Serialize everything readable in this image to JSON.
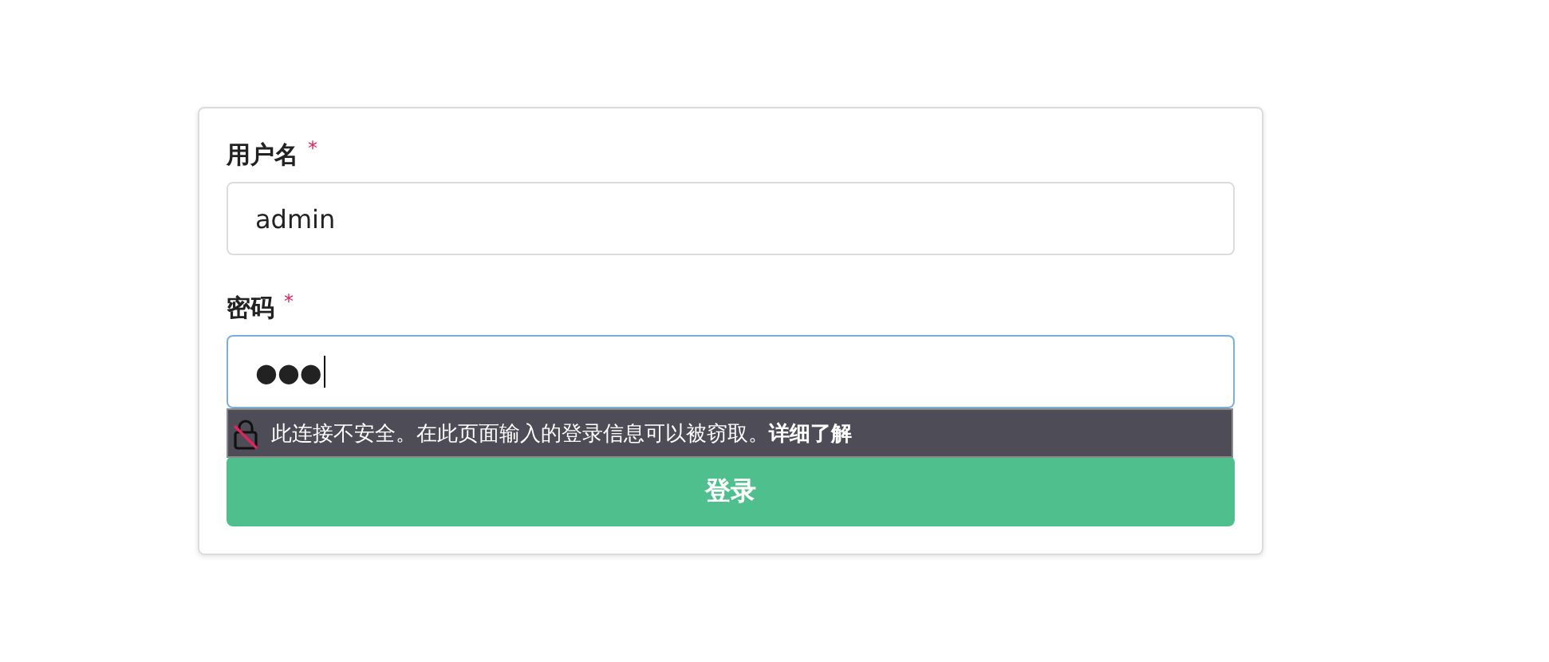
{
  "form": {
    "fields": [
      {
        "label": "用户名",
        "required_mark": "*",
        "value": "admin",
        "focused": false
      },
      {
        "label": "密码",
        "required_mark": "*",
        "value": "●●●",
        "focused": true
      }
    ],
    "security_warning": {
      "message": "此连接不安全。在此页面输入的登录信息可以被窃取。",
      "link": "详细了解"
    },
    "submit_button": "登录"
  }
}
